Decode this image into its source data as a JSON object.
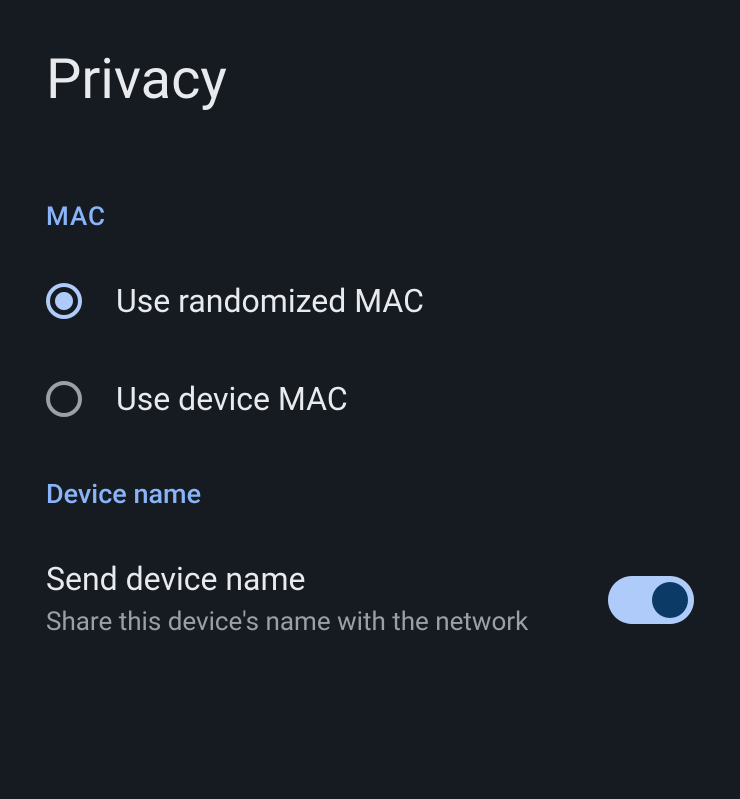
{
  "page_title": "Privacy",
  "mac_section": {
    "header": "MAC",
    "options": [
      {
        "label": "Use randomized MAC",
        "selected": true
      },
      {
        "label": "Use device MAC",
        "selected": false
      }
    ]
  },
  "device_section": {
    "header": "Device name",
    "toggle": {
      "title": "Send device name",
      "subtitle": "Share this device's name with the network",
      "enabled": true
    }
  }
}
